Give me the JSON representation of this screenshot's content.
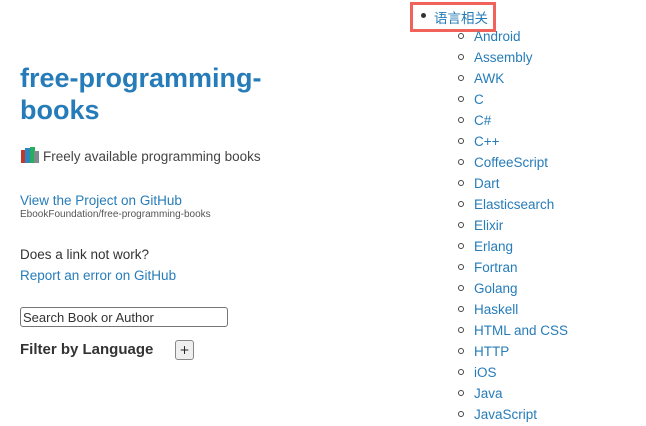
{
  "header": {
    "title": "free-programming-books",
    "tagline": "Freely available programming books"
  },
  "github": {
    "link_label": "View the Project on GitHub",
    "repo": "EbookFoundation/free-programming-books"
  },
  "report": {
    "question": "Does a link not work?",
    "link_label": "Report an error on GitHub"
  },
  "search": {
    "placeholder": "Search Book or Author",
    "value": ""
  },
  "filter": {
    "label": "Filter by Language",
    "toggle_label": "+"
  },
  "section": {
    "title": "语言相关",
    "languages": [
      "Android",
      "Assembly",
      "AWK",
      "C",
      "C#",
      "C++",
      "CoffeeScript",
      "Dart",
      "Elasticsearch",
      "Elixir",
      "Erlang",
      "Fortran",
      "Golang",
      "Haskell",
      "HTML and CSS",
      "HTTP",
      "iOS",
      "Java",
      "JavaScript"
    ]
  },
  "colors": {
    "link": "#267CB9",
    "highlight": "#F0625A"
  },
  "icons": {
    "tagline_icon": "books-icon"
  }
}
